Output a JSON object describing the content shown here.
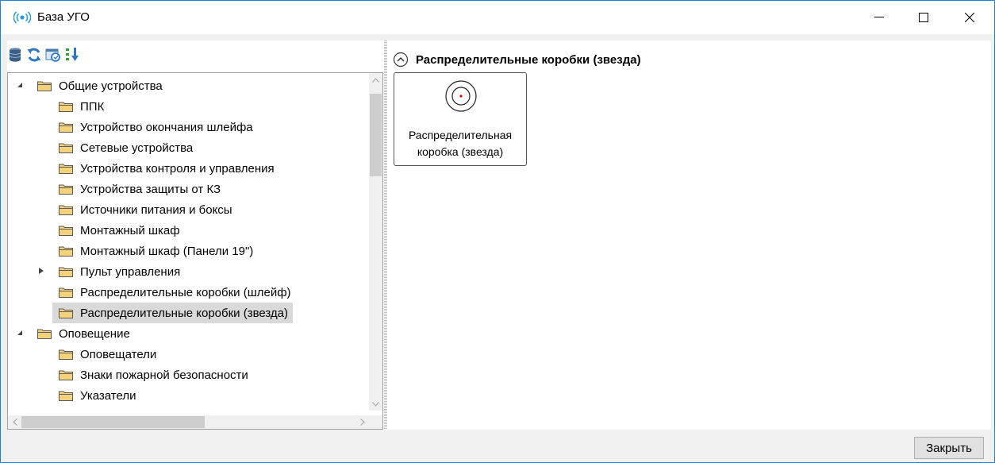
{
  "window": {
    "title": "База УГО"
  },
  "toolbar": {
    "icons": [
      "database-icon",
      "refresh-icon",
      "sync-icon",
      "sort-icon"
    ]
  },
  "tree": {
    "items": [
      {
        "label": "Общие устройства",
        "expanded": true
      },
      {
        "label": "ППК"
      },
      {
        "label": "Устройство окончания шлейфа"
      },
      {
        "label": "Сетевые устройства"
      },
      {
        "label": "Устройства контроля и управления"
      },
      {
        "label": "Устройства защиты от КЗ"
      },
      {
        "label": "Источники питания и боксы"
      },
      {
        "label": "Монтажный шкаф"
      },
      {
        "label": "Монтажный шкаф (Панели 19\")"
      },
      {
        "label": "Пульт управления",
        "expanded": false
      },
      {
        "label": "Распределительные коробки (шлейф)"
      },
      {
        "label": "Распределительные коробки (звезда)",
        "selected": true
      },
      {
        "label": "Оповещение",
        "expanded": true
      },
      {
        "label": "Оповещатели"
      },
      {
        "label": "Знаки пожарной безопасности"
      },
      {
        "label": "Указатели"
      }
    ]
  },
  "group": {
    "title": "Распределительные коробки (звезда)",
    "tile": {
      "label_line1": "Распределительная",
      "label_line2": "коробка (звезда)"
    }
  },
  "footer": {
    "close_label": "Закрыть"
  },
  "colors": {
    "window_border": "#1883d7",
    "selection": "#d9d9d9",
    "folder": "#f3d27a",
    "marker": "#e00000"
  }
}
